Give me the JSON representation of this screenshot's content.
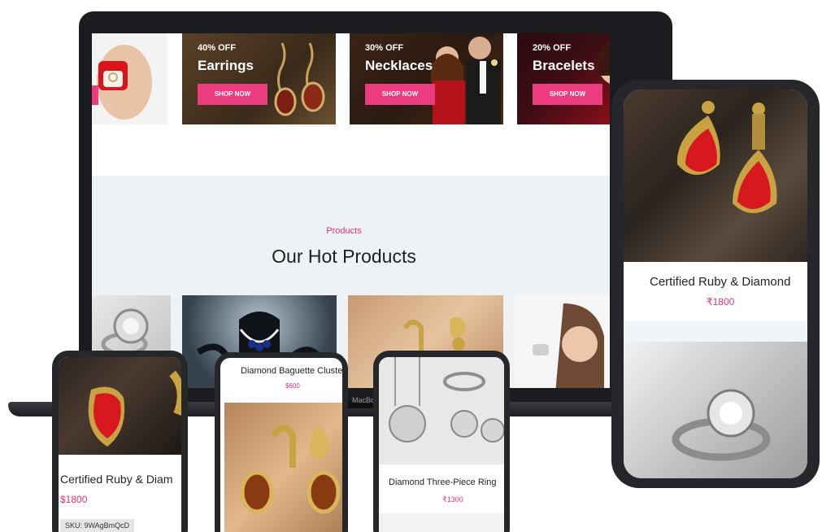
{
  "laptop": {
    "brand_text": "MacBo",
    "banners": [
      {
        "discount": "40% OFF",
        "name": "Earrings",
        "cta": "SHOP NOW"
      },
      {
        "discount": "30% OFF",
        "name": "Necklaces",
        "cta": "SHOP NOW"
      },
      {
        "discount": "20% OFF",
        "name": "Bracelets",
        "cta": "SHOP NOW"
      }
    ],
    "section": {
      "eyebrow": "Products",
      "title": "Our Hot Products"
    }
  },
  "phone_big": {
    "product_name": "Certified Ruby & Diamond",
    "price": "₹1800"
  },
  "phone_small_1": {
    "product_name": "Certified Ruby & Diam",
    "price": "$1800",
    "sku": "SKU: 9WAgBmQcD"
  },
  "phone_small_2": {
    "product_name": "Diamond Baguette Cluste",
    "price": "$600"
  },
  "phone_small_3": {
    "product_name": "Diamond Three-Piece Ring",
    "price": "₹1300"
  },
  "colors": {
    "accent": "#e8317a",
    "button": "#ec3b7f",
    "section_bg": "#eef2f5",
    "device": "#1b1c1f"
  }
}
